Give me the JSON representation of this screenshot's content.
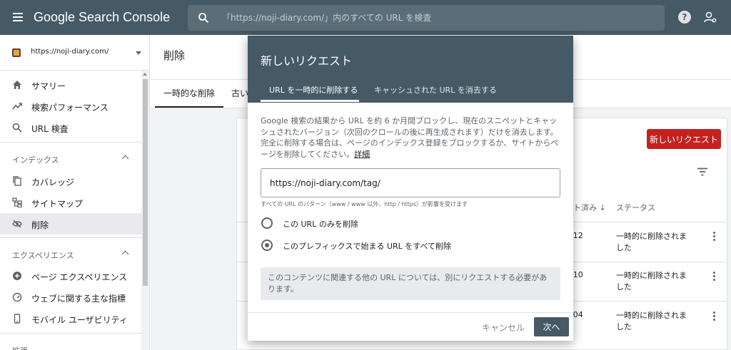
{
  "topbar": {
    "app_name": "Google Search Console",
    "search_placeholder": "「https://noji-diary.com/」内のすべての URL を検査"
  },
  "sidebar": {
    "property": "https://noji-diary.com/",
    "items": [
      {
        "label": "サマリー",
        "icon": "home-icon"
      },
      {
        "label": "検索パフォーマンス",
        "icon": "trending-icon"
      },
      {
        "label": "URL 検査",
        "icon": "search-icon"
      }
    ],
    "index_section": "インデックス",
    "index_items": [
      {
        "label": "カバレッジ",
        "icon": "copy-icon"
      },
      {
        "label": "サイトマップ",
        "icon": "sitemap-icon"
      },
      {
        "label": "削除",
        "icon": "eye-off-icon"
      }
    ],
    "experience_section": "エクスペリエンス",
    "experience_items": [
      {
        "label": "ページ エクスペリエンス",
        "icon": "plus-circle-icon"
      },
      {
        "label": "ウェブに関する主な指標",
        "icon": "gauge-icon"
      },
      {
        "label": "モバイル ユーザビリティ",
        "icon": "phone-icon"
      }
    ],
    "extensions_section": "拡張"
  },
  "main": {
    "title": "削除",
    "tabs": [
      "一時的な削除",
      "古い"
    ],
    "new_request_button": "新しいリクエスト",
    "col_submitted": "ト済み ↓",
    "col_status": "ステータス",
    "rows": [
      {
        "date": "/12",
        "status": "一時的に削除されました"
      },
      {
        "date": "/10",
        "status": "一時的に削除されました"
      },
      {
        "date": "/04",
        "status": "一時的に削除されました"
      }
    ]
  },
  "dialog": {
    "title": "新しいリクエスト",
    "tab_active": "URL を一時的に削除する",
    "tab_inactive": "キャッシュされた URL を消去する",
    "description": "Google 検索の結果から URL を約 6 か月間ブロックし、現在のスニペットとキャッシュされたバージョン（次回のクロールの後に再生成されます）だけを消去します。完全に削除する場合は、ページのインデックス登録をブロックするか、サイトからページを削除してください。",
    "details_link": "詳細",
    "url_value": "https://noji-diary.com/tag/",
    "url_hint": "すべての URL のパターン（www / www 以外、http / https）が影響を受けます",
    "option_single": "この URL のみを削除",
    "option_prefix": "このプレフィックスで始まる URL をすべて削除",
    "selected_option": "prefix",
    "note": "このコンテンツに関連する他の URL については、別にリクエストする必要があります。",
    "cancel_button": "キャンセル",
    "next_button": "次へ"
  }
}
